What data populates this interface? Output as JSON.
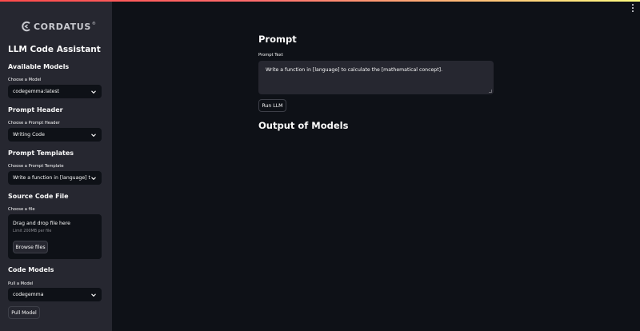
{
  "brand": {
    "name": "CORDATUS",
    "mark": "®"
  },
  "sidebar": {
    "title": "LLM Code Assistant",
    "available_models": {
      "heading": "Available Models",
      "label": "Choose a Model",
      "value": "codegemma:latest"
    },
    "prompt_header": {
      "heading": "Prompt Header",
      "label": "Choose a Prompt Header",
      "value": "Writing Code"
    },
    "prompt_templates": {
      "heading": "Prompt Templates",
      "label": "Choose a Prompt Template",
      "value": "Write a function in [language] t..."
    },
    "source_code_file": {
      "heading": "Source Code File",
      "label": "Choose a file",
      "drop_title": "Drag and drop file here",
      "drop_limit": "Limit 200MB per file",
      "browse_label": "Browse files"
    },
    "code_models": {
      "heading": "Code Models",
      "label": "Pull a Model",
      "value": "codegemma",
      "pull_label": "Pull Model"
    }
  },
  "main": {
    "prompt_heading": "Prompt",
    "prompt_label": "Prompt Text",
    "prompt_value": "Write a function in [language] to calculate the [mathematical concept].",
    "run_label": "Run LLM",
    "output_heading": "Output of Models"
  },
  "colors": {
    "background": "#0e1117",
    "sidebar": "#262730",
    "accent": "#ff4b4b"
  },
  "icons": [
    "cordatus-logo-icon",
    "chevron-down-icon",
    "kebab-menu-icon"
  ]
}
